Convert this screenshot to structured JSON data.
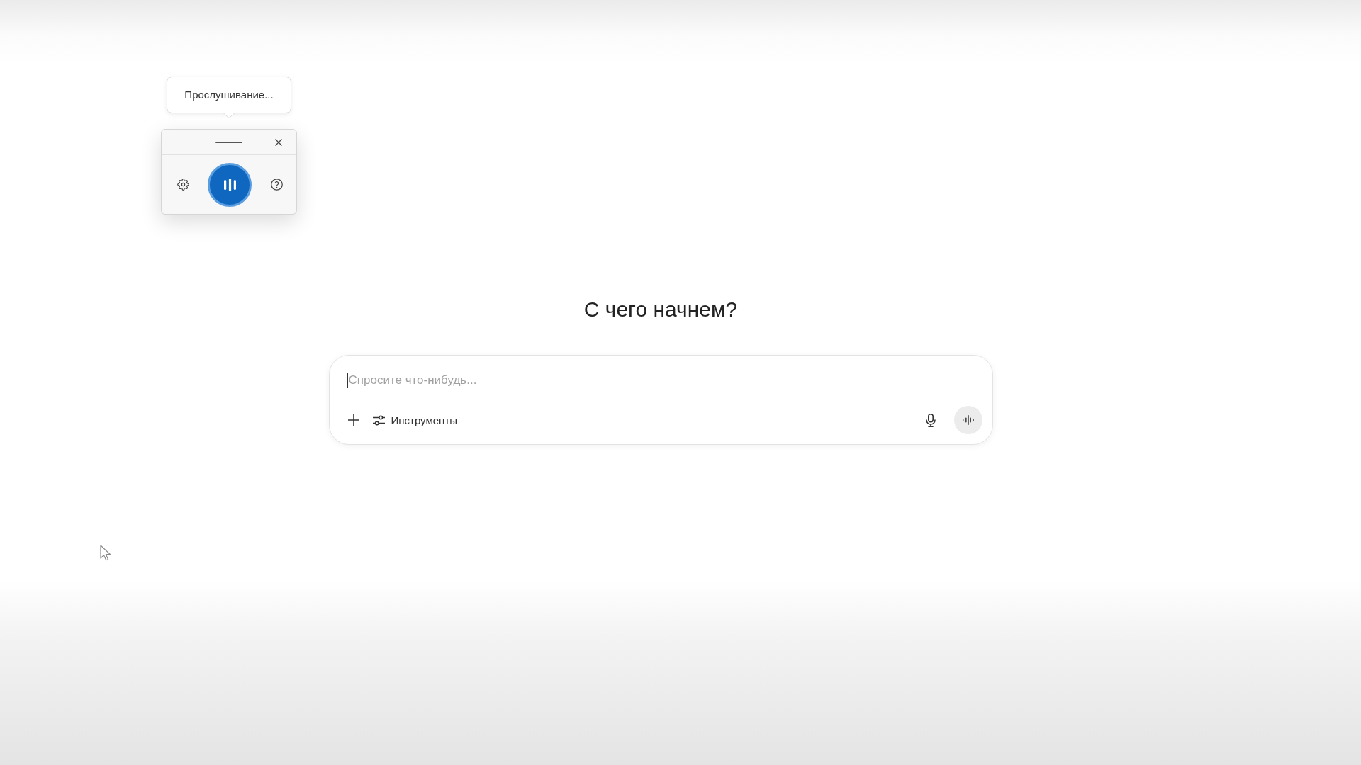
{
  "voice_widget": {
    "tooltip": "Прослушивание...",
    "listening": true
  },
  "heading": "С чего начнем?",
  "composer": {
    "placeholder": "Спросите что-нибудь...",
    "focused": true,
    "tools_label": "Инструменты"
  }
}
